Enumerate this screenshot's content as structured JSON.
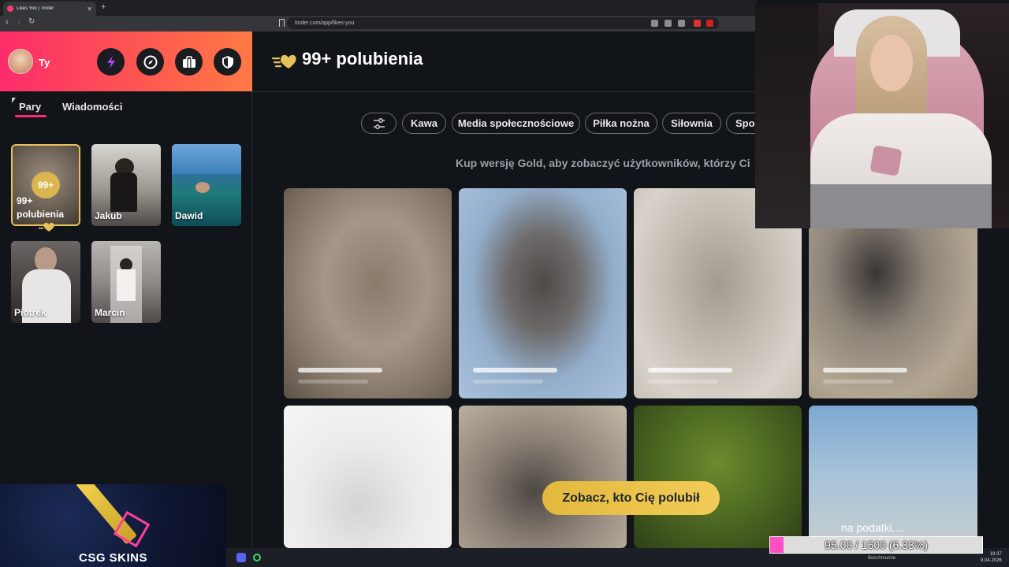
{
  "browser": {
    "tab_title": "Likes You | Tinder",
    "url": "tinder.com/app/likes-you"
  },
  "sidebar": {
    "username": "Ty",
    "tabs": [
      "Pary",
      "Wiadomości"
    ],
    "likes_card": {
      "count": "99+",
      "label": "99+ polubienia"
    },
    "matches": [
      {
        "name": "Jakub"
      },
      {
        "name": "Dawid"
      },
      {
        "name": "Piotrek"
      },
      {
        "name": "Marcin"
      }
    ]
  },
  "main": {
    "title": "99+ polubienia",
    "filters": [
      "Kawa",
      "Media społecznościowe",
      "Piłka nożna",
      "Siłownia",
      "Spor"
    ],
    "gold_prompt": "Kup wersję Gold, aby zobaczyć użytkowników, którzy Ci",
    "cta": "Zobacz, kto Cię polubił"
  },
  "overlay": {
    "ad_brand": "CSG SKINS",
    "goal_text": "na podatki....",
    "goal_progress": "95.00 / 1500 (6.33%)",
    "goal_fraction": 0.0633,
    "taskbar_caption": "Bezchmurnie",
    "clock_time": "19:37",
    "clock_date": "9.04.2026"
  },
  "colors": {
    "brand_gradient_start": "#fd2c6a",
    "brand_gradient_end": "#ff7a45",
    "gold": "#e3b83d",
    "goal_fill": "#ff4fc4"
  }
}
